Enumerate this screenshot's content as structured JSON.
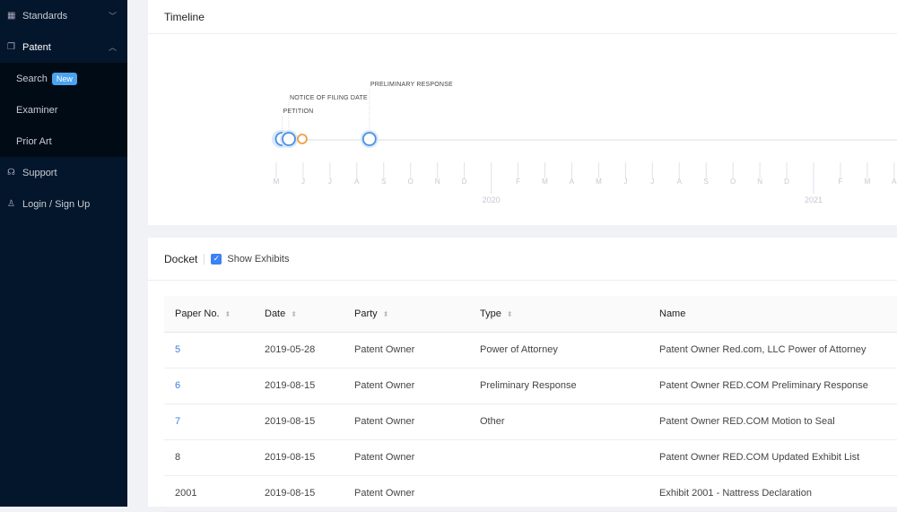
{
  "sidebar": {
    "items": [
      {
        "label": "Standards",
        "icon": "grid-icon",
        "expanded": false
      },
      {
        "label": "Patent",
        "icon": "folder-icon",
        "expanded": true
      },
      {
        "label": "Search",
        "badge": "New"
      },
      {
        "label": "Examiner"
      },
      {
        "label": "Prior Art"
      },
      {
        "label": "Support",
        "icon": "headset-icon"
      },
      {
        "label": "Login / Sign Up",
        "icon": "user-icon"
      }
    ]
  },
  "timeline": {
    "title": "Timeline",
    "months": [
      "M",
      "J",
      "J",
      "A",
      "S",
      "O",
      "N",
      "D",
      "",
      "F",
      "M",
      "A",
      "M",
      "J",
      "J",
      "A",
      "S",
      "O",
      "N",
      "D",
      "",
      "F",
      "M",
      "A"
    ],
    "years": [
      {
        "label": "2020",
        "index": 8
      },
      {
        "label": "2021",
        "index": 20
      }
    ],
    "events": [
      {
        "label": "",
        "month_offset": 0.1,
        "color": "#4a90e2"
      },
      {
        "label": "PETITION",
        "month_offset": 0.15,
        "color": "#4a90e2",
        "level": 1
      },
      {
        "label": "NOTICE OF FILING DATE",
        "month_offset": 0.4,
        "color": "#4a90e2",
        "level": 2
      },
      {
        "label": "",
        "month_offset": 0.9,
        "color": "#f0a040"
      },
      {
        "label": "PRELIMINARY RESPONSE",
        "month_offset": 3.4,
        "color": "#4a90e2",
        "level": 3
      }
    ]
  },
  "docket": {
    "title": "Docket",
    "show_exhibits": "Show Exhibits",
    "show_exhibits_checked": true,
    "columns": [
      "Paper No.",
      "Date",
      "Party",
      "Type",
      "Name"
    ],
    "rows": [
      [
        "5",
        "2019-05-28",
        "Patent Owner",
        "Power of Attorney",
        "Patent Owner Red.com, LLC Power of Attorney"
      ],
      [
        "6",
        "2019-08-15",
        "Patent Owner",
        "Preliminary Response",
        "Patent Owner RED.COM Preliminary Response"
      ],
      [
        "7",
        "2019-08-15",
        "Patent Owner",
        "Other",
        "Patent Owner RED.COM Motion to Seal"
      ],
      [
        "8",
        "2019-08-15",
        "Patent Owner",
        "",
        "Patent Owner RED.COM Updated Exhibit List"
      ],
      [
        "2001",
        "2019-08-15",
        "Patent Owner",
        "",
        "Exhibit 2001 - Nattress Declaration"
      ]
    ],
    "linked_rows": [
      0,
      1,
      2
    ]
  }
}
